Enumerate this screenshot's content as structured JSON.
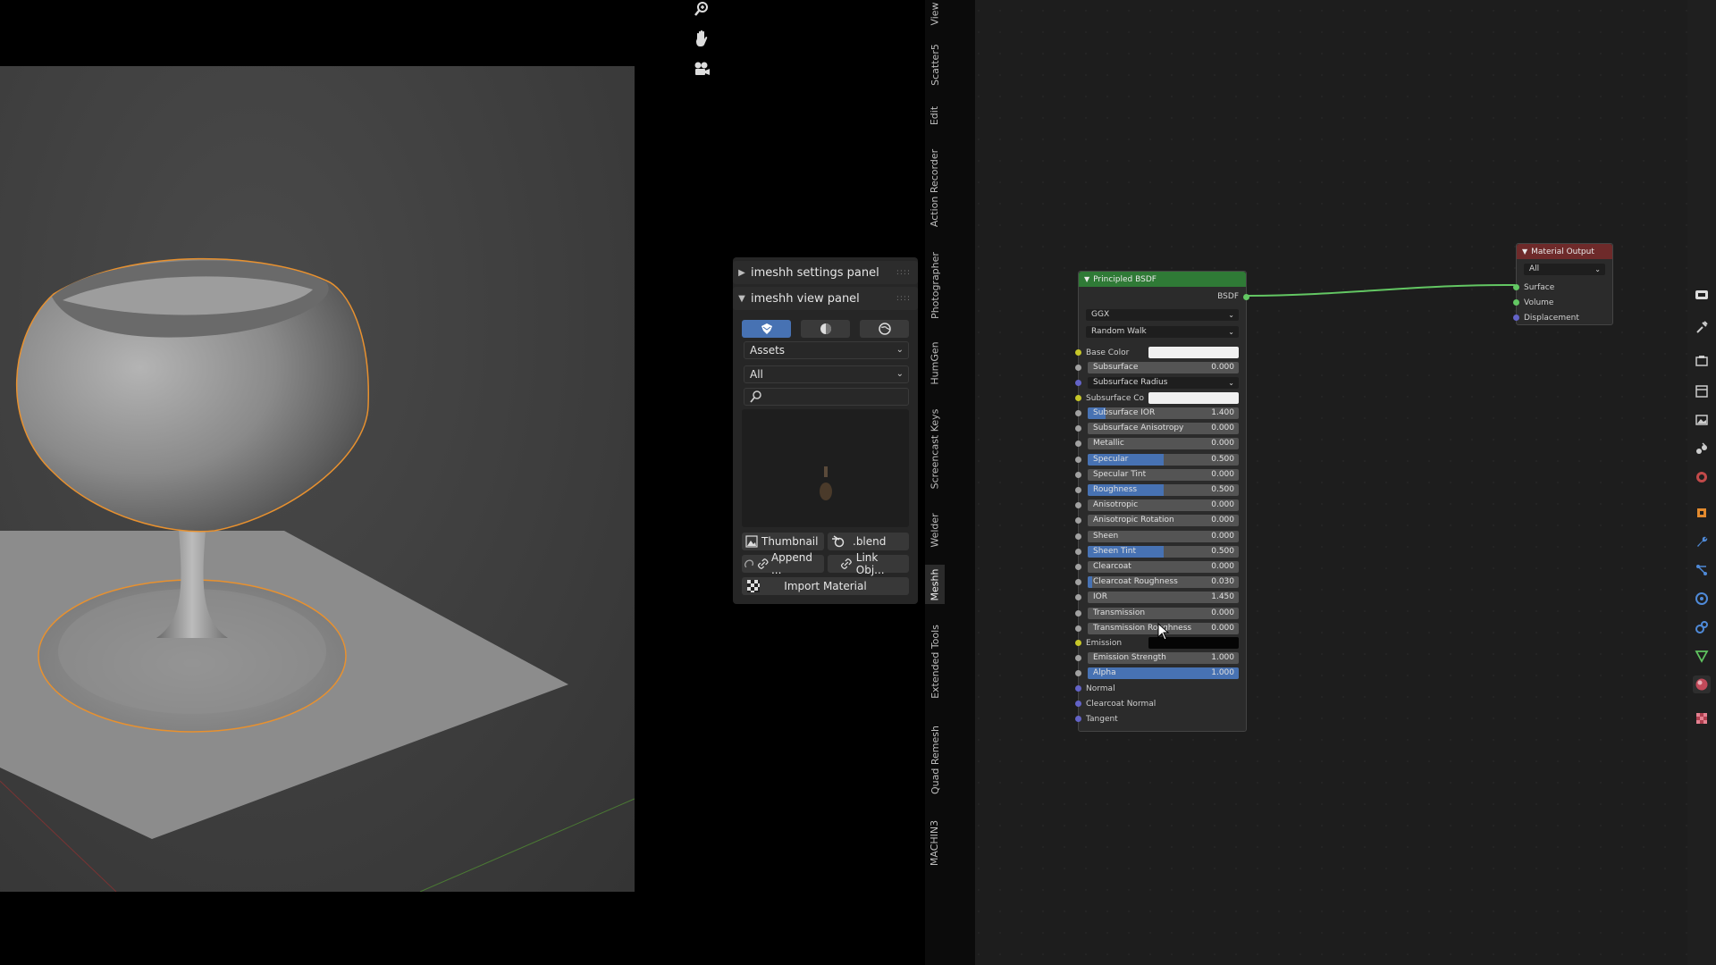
{
  "tabs": [
    "View",
    "Scatter5",
    "Edit",
    "Action Recorder",
    "Photographer",
    "HumGen",
    "Screencast Keys",
    "Welder",
    "Meshh",
    "Extended Tools",
    "Quad Remesh",
    "MACHIN3"
  ],
  "imeshh": {
    "settings_title": "imeshh settings panel",
    "view_title": "imeshh view panel",
    "assets_value": "Assets",
    "filter_value": "All",
    "search_placeholder": "",
    "thumbnail_label": "Thumbnail",
    "blend_label": ".blend",
    "append_label": "Append ...",
    "link_label": "Link Obj...",
    "import_label": "Import Material"
  },
  "bsdf": {
    "title": "Principled BSDF",
    "output_label": "BSDF",
    "distribution": "GGX",
    "subsurface_method": "Random Walk",
    "base_color_label": "Base Color",
    "subsurface": {
      "label": "Subsurface",
      "value": "0.000",
      "fraction": 0.0
    },
    "subsurface_radius_label": "Subsurface Radius",
    "subsurface_color_label": "Subsurface Co",
    "params": [
      {
        "label": "Subsurface IOR",
        "value": "1.400",
        "fraction": 0.12
      },
      {
        "label": "Subsurface Anisotropy",
        "value": "0.000",
        "fraction": 0.0
      },
      {
        "label": "Metallic",
        "value": "0.000",
        "fraction": 0.0
      },
      {
        "label": "Specular",
        "value": "0.500",
        "fraction": 0.5
      },
      {
        "label": "Specular Tint",
        "value": "0.000",
        "fraction": 0.0
      },
      {
        "label": "Roughness",
        "value": "0.500",
        "fraction": 0.5
      },
      {
        "label": "Anisotropic",
        "value": "0.000",
        "fraction": 0.0
      },
      {
        "label": "Anisotropic Rotation",
        "value": "0.000",
        "fraction": 0.0
      },
      {
        "label": "Sheen",
        "value": "0.000",
        "fraction": 0.0
      },
      {
        "label": "Sheen Tint",
        "value": "0.500",
        "fraction": 0.5
      },
      {
        "label": "Clearcoat",
        "value": "0.000",
        "fraction": 0.0
      },
      {
        "label": "Clearcoat Roughness",
        "value": "0.030",
        "fraction": 0.03
      },
      {
        "label": "IOR",
        "value": "1.450",
        "fraction": 0.0
      },
      {
        "label": "Transmission",
        "value": "0.000",
        "fraction": 0.0
      },
      {
        "label": "Transmission Roughness",
        "value": "0.000",
        "fraction": 0.0
      }
    ],
    "emission_label": "Emission",
    "emission_strength": {
      "label": "Emission Strength",
      "value": "1.000",
      "fraction": 0.0
    },
    "alpha": {
      "label": "Alpha",
      "value": "1.000",
      "fraction": 1.0
    },
    "normal_label": "Normal",
    "clearcoat_normal_label": "Clearcoat Normal",
    "tangent_label": "Tangent"
  },
  "material_output": {
    "title": "Material Output",
    "target": "All",
    "surface_label": "Surface",
    "volume_label": "Volume",
    "displacement_label": "Displacement"
  },
  "colors": {
    "accent_blue": "#4772b3",
    "node_header_green": "#2f7a36",
    "output_header_red": "#6e2a2a",
    "selection_orange": "#e8912f"
  }
}
